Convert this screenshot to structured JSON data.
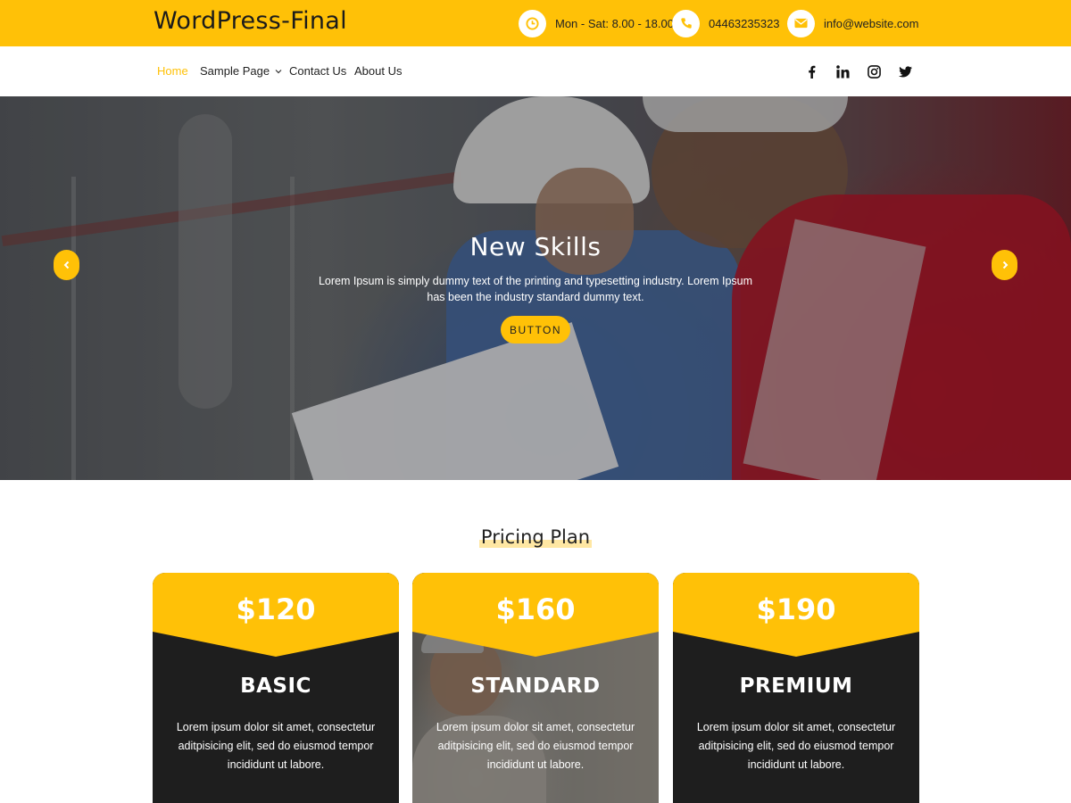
{
  "header": {
    "brand": "WordPress-Final",
    "hours": "Mon - Sat: 8.00 - 18.00",
    "phone": "04463235323",
    "email": "info@website.com"
  },
  "nav": {
    "items": [
      {
        "label": "Home",
        "active": true
      },
      {
        "label": "Sample Page",
        "has_dropdown": true
      },
      {
        "label": "Contact Us"
      },
      {
        "label": "About Us"
      }
    ],
    "social": [
      "facebook-icon",
      "linkedin-icon",
      "instagram-icon",
      "twitter-icon"
    ]
  },
  "hero": {
    "title": "New Skills",
    "text": "Lorem Ipsum is simply dummy text of the printing and typesetting industry. Lorem Ipsum has been the industry standard dummy text.",
    "button": "BUTTON"
  },
  "pricing": {
    "title": "Pricing Plan",
    "plans": [
      {
        "price": "$120",
        "name": "BASIC",
        "desc": "Lorem ipsum dolor sit amet, consectetur aditpisicing elit, sed do eiusmod tempor incididunt ut labore."
      },
      {
        "price": "$160",
        "name": "STANDARD",
        "desc": "Lorem ipsum dolor sit amet, consectetur aditpisicing elit, sed do eiusmod tempor incididunt ut labore."
      },
      {
        "price": "$190",
        "name": "PREMIUM",
        "desc": "Lorem ipsum dolor sit amet, consectetur aditpisicing elit, sed do eiusmod tempor incididunt ut labore."
      }
    ]
  },
  "colors": {
    "accent": "#ffc107",
    "dark": "#1e1e1e",
    "text": "#222222"
  }
}
